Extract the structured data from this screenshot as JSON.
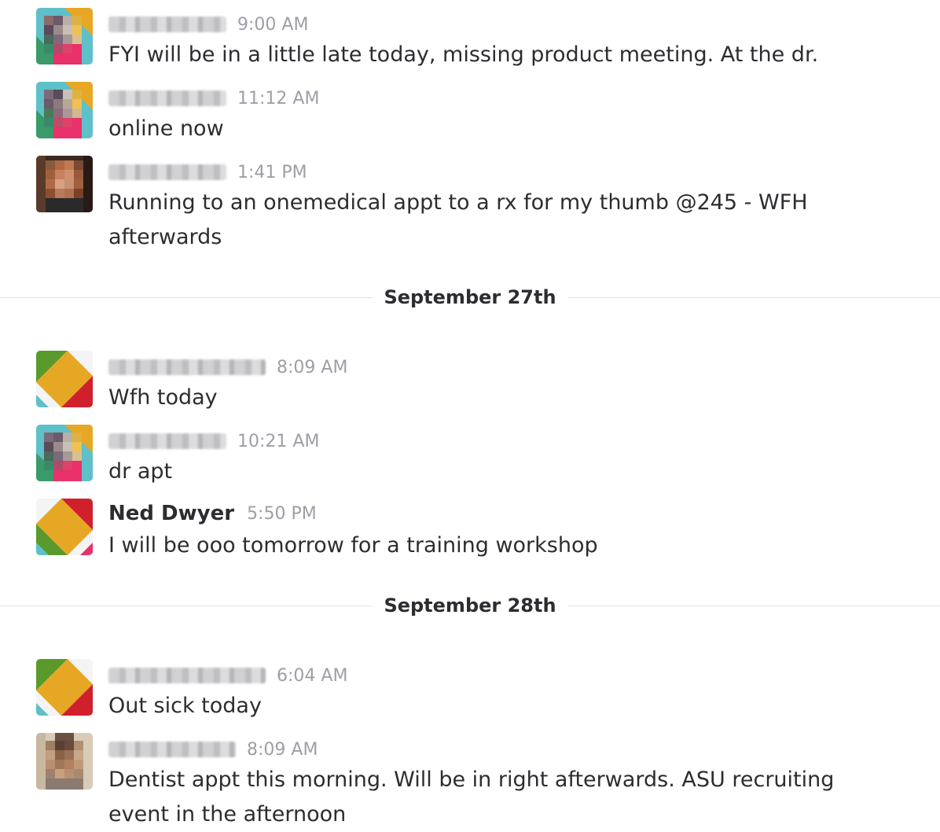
{
  "messages_group_1": [
    {
      "time": "9:00 AM",
      "text": "FYI will be in a little late today, missing product meeting. At the dr.",
      "avatar_icon": "pixelated-avatar-icon"
    },
    {
      "time": "11:12 AM",
      "text": "online now",
      "avatar_icon": "pixelated-avatar-icon"
    },
    {
      "time": "1:41 PM",
      "text": "Running to an onemedical appt to a rx for my thumb @245 - WFH afterwards",
      "avatar_icon": "pixelated-photo-avatar-icon"
    }
  ],
  "dividers": [
    "September 27th",
    "September 28th"
  ],
  "messages_group_2": [
    {
      "time": "8:09 AM",
      "text": "Wfh today",
      "avatar_icon": "default-geometric-avatar-icon"
    },
    {
      "time": "10:21 AM",
      "text": "dr apt",
      "avatar_icon": "pixelated-avatar-icon"
    },
    {
      "sender": "Ned Dwyer",
      "time": "5:50 PM",
      "text": "I will be ooo tomorrow for a training workshop",
      "avatar_icon": "default-geometric-avatar-icon"
    }
  ],
  "messages_group_3": [
    {
      "time": "6:04 AM",
      "text": "Out sick today",
      "avatar_icon": "default-geometric-avatar-icon"
    },
    {
      "time": "8:09 AM",
      "text": "Dentist appt this morning.  Will be in right afterwards. ASU recruiting event in the afternoon",
      "avatar_icon": "pixelated-photo-avatar-icon"
    }
  ],
  "colors": {
    "text": "#2c2d30",
    "timestamp": "#9e9ea6",
    "divider_line": "#e3e3e6",
    "avatar_yellow": "#e6a824",
    "avatar_green": "#5a9a2c",
    "avatar_red": "#d0202c",
    "avatar_pink": "#e8306a",
    "avatar_teal": "#5ec0c8"
  }
}
